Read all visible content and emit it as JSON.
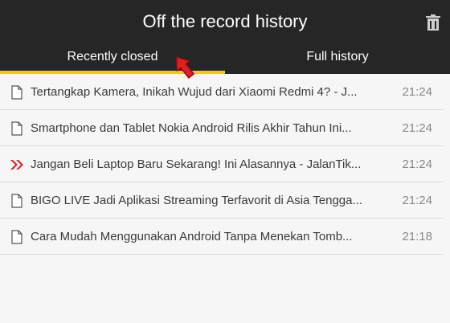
{
  "header": {
    "title": "Off the record history",
    "trash_icon": "trash-icon"
  },
  "tabs": [
    {
      "label": "Recently closed",
      "active": true,
      "accent": "#f0d000"
    },
    {
      "label": "Full history",
      "active": false
    }
  ],
  "items": [
    {
      "icon": "page-icon",
      "title": "Tertangkap Kamera, Inikah Wujud dari Xiaomi Redmi 4? - J...",
      "time": "21:24"
    },
    {
      "icon": "page-icon",
      "title": "Smartphone dan Tablet Nokia Android Rilis Akhir Tahun Ini...",
      "time": "21:24"
    },
    {
      "icon": "jalantikus-icon",
      "title": "Jangan Beli Laptop Baru Sekarang! Ini Alasannya - JalanTik...",
      "time": "21:24"
    },
    {
      "icon": "page-icon",
      "title": "BIGO LIVE Jadi Aplikasi Streaming Terfavorit di Asia Tengga...",
      "time": "21:24"
    },
    {
      "icon": "page-icon",
      "title": "Cara Mudah Menggunakan Android Tanpa Menekan Tomb...",
      "time": "21:18"
    }
  ],
  "colors": {
    "header_bg": "#262626",
    "accent": "#f0d000",
    "favicon_red": "#d7262a",
    "cursor_red": "#e02020"
  }
}
